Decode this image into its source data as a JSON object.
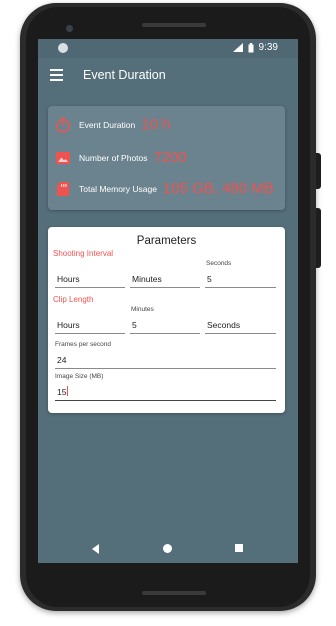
{
  "status_bar": {
    "time": "9:39",
    "network_label": "LTE"
  },
  "app_bar": {
    "title": "Event Duration"
  },
  "summary": {
    "event_duration": {
      "label": "Event Duration",
      "value": "10 h"
    },
    "photos": {
      "label": "Number of Photos",
      "value": "7200"
    },
    "memory": {
      "label": "Total Memory Usage",
      "value": "105 GB, 480 MB"
    }
  },
  "parameters": {
    "title": "Parameters",
    "shooting_interval": {
      "section_label": "Shooting Interval",
      "hours": "Hours",
      "minutes": "Minutes",
      "seconds_label": "Seconds",
      "seconds_value": "5"
    },
    "clip_length": {
      "section_label": "Clip Length",
      "hours": "Hours",
      "minutes_label": "Minutes",
      "minutes_value": "5",
      "seconds": "Seconds"
    },
    "fps": {
      "label": "Frames per second",
      "value": "24"
    },
    "image_size": {
      "label": "Image Size (MB)",
      "value": "15"
    }
  },
  "colors": {
    "primary": "#546e7a",
    "accent": "#ef5350"
  },
  "icons": {
    "menu": "hamburger-menu-icon",
    "timer": "timer-icon",
    "photo": "photo-icon",
    "memory": "sd-card-icon"
  }
}
